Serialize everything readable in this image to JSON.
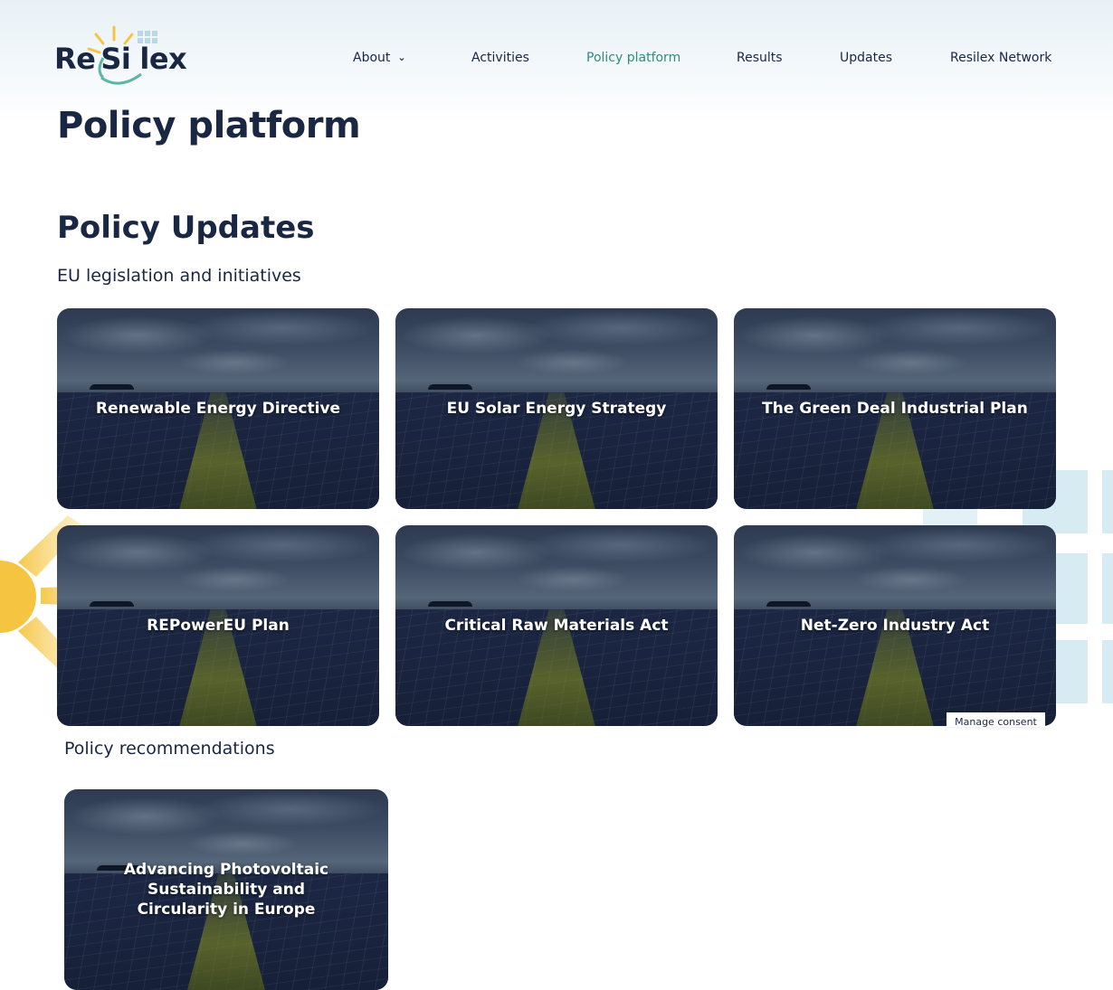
{
  "logo": {
    "alt_parts": [
      "Re",
      "Si",
      "lex"
    ]
  },
  "nav": {
    "items": [
      {
        "label": "About",
        "has_dropdown": true,
        "active": false
      },
      {
        "label": "Activities",
        "active": false
      },
      {
        "label": "Policy platform",
        "active": true
      },
      {
        "label": "Results",
        "active": false
      },
      {
        "label": "Updates",
        "active": false
      },
      {
        "label": "Resilex Network",
        "active": false
      }
    ]
  },
  "page": {
    "title": "Policy platform",
    "section_title": "Policy Updates",
    "eu_subheading": "EU legislation and initiatives",
    "recommendations_subheading": "Policy recommendations"
  },
  "eu_cards": [
    {
      "title": "Renewable Energy Directive"
    },
    {
      "title": "EU Solar Energy Strategy"
    },
    {
      "title": "The Green Deal Industrial Plan"
    },
    {
      "title": "REPowerEU Plan"
    },
    {
      "title": "Critical Raw Materials Act"
    },
    {
      "title": "Net-Zero Industry Act"
    }
  ],
  "recommendation_cards": [
    {
      "title": "Advancing Photovoltaic Sustainability and Circularity in Europe"
    }
  ],
  "consent": {
    "label": "Manage consent"
  },
  "colors": {
    "navy": "#1a2743",
    "accent_teal": "#2f8a80",
    "sun_yellow": "#f5c542",
    "panel_blue": "#cfe6ef"
  }
}
